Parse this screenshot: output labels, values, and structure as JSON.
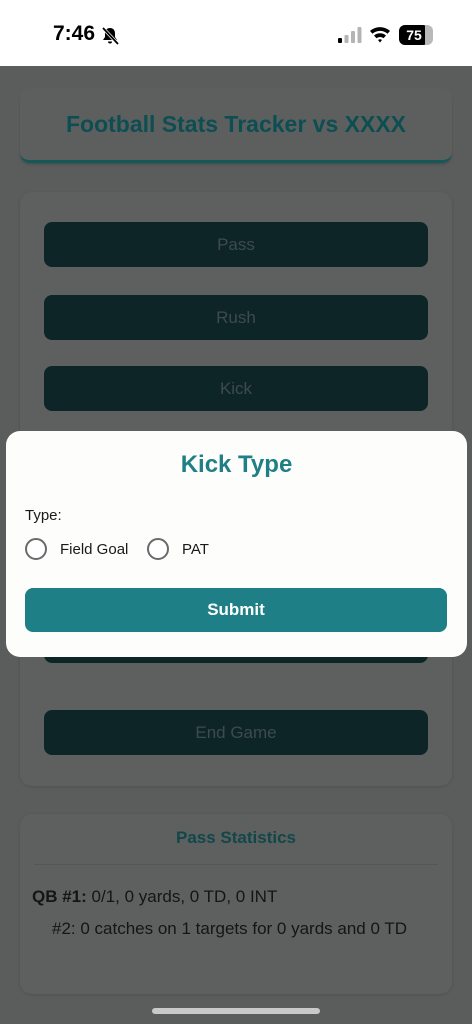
{
  "status_bar": {
    "time": "7:46",
    "battery": "75"
  },
  "header": {
    "title": "Football Stats Tracker vs XXXX"
  },
  "actions": {
    "pass_label": "Pass",
    "rush_label": "Rush",
    "kick_label": "Kick",
    "end_game_label": "End Game"
  },
  "stats": {
    "title": "Pass Statistics",
    "qb_label": "QB #1:",
    "qb_line": " 0/1, 0 yards, 0 TD, 0 INT",
    "receiver_line": "#2: 0 catches on 1 targets for 0 yards and 0 TD"
  },
  "modal": {
    "title": "Kick Type",
    "type_label": "Type:",
    "options": [
      {
        "label": "Field Goal",
        "selected": false
      },
      {
        "label": "PAT",
        "selected": false
      }
    ],
    "submit_label": "Submit"
  },
  "colors": {
    "accent": "#1f7f86",
    "overlay_dim": "#5b5d5c",
    "button_dark": "#0e2527"
  }
}
